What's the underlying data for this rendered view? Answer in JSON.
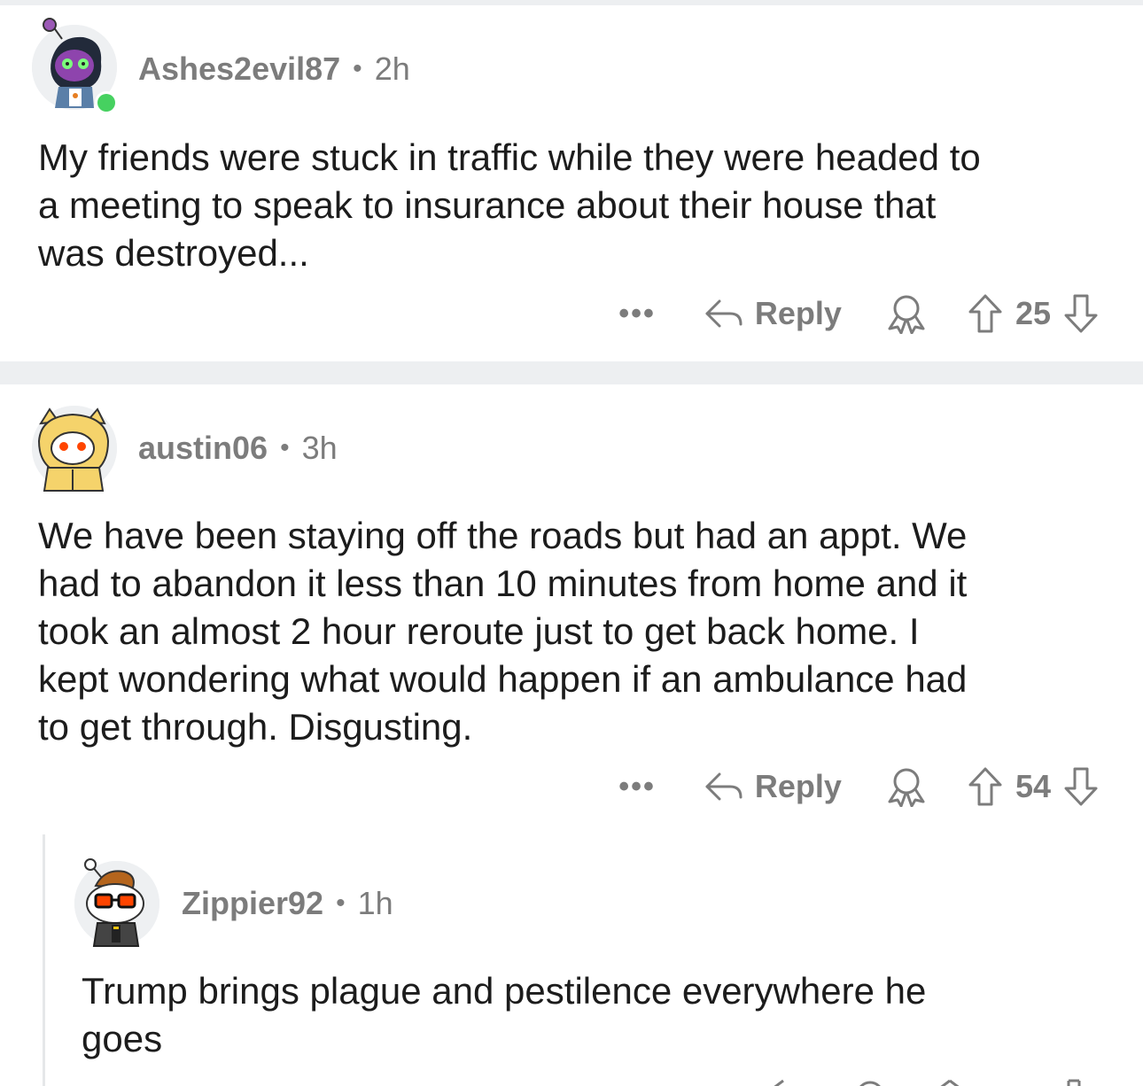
{
  "comments": [
    {
      "username": "Ashes2evil87",
      "separator": "•",
      "age": "2h",
      "lines": [
        "My friends were stuck in traffic while they were headed to",
        "a meeting to speak to insurance about their house that",
        "was destroyed..."
      ],
      "more": "•••",
      "reply_label": "Reply",
      "score": "25",
      "online": true
    },
    {
      "username": "austin06",
      "separator": "•",
      "age": "3h",
      "lines": [
        "We have been staying off the roads but had an appt. We",
        "had to abandon it less than 10 minutes from home and it",
        "took an almost 2 hour reroute just to get back home. I",
        "kept wondering what would happen if an ambulance had",
        "to get through. Disgusting."
      ],
      "more": "•••",
      "reply_label": "Reply",
      "score": "54"
    },
    {
      "username": "Zippier92",
      "separator": "•",
      "age": "1h",
      "lines": [
        "Trump brings plague and pestilence everywhere he",
        "goes"
      ]
    }
  ],
  "icons": {
    "more": "ellipsis-icon",
    "reply": "reply-arrow-icon",
    "award": "award-icon",
    "upvote": "upvote-arrow-icon",
    "downvote": "downvote-arrow-icon"
  },
  "colors": {
    "text": "#1c1c1c",
    "meta": "#7c7c7c",
    "separator": "#edeff1",
    "online": "#46d160"
  }
}
